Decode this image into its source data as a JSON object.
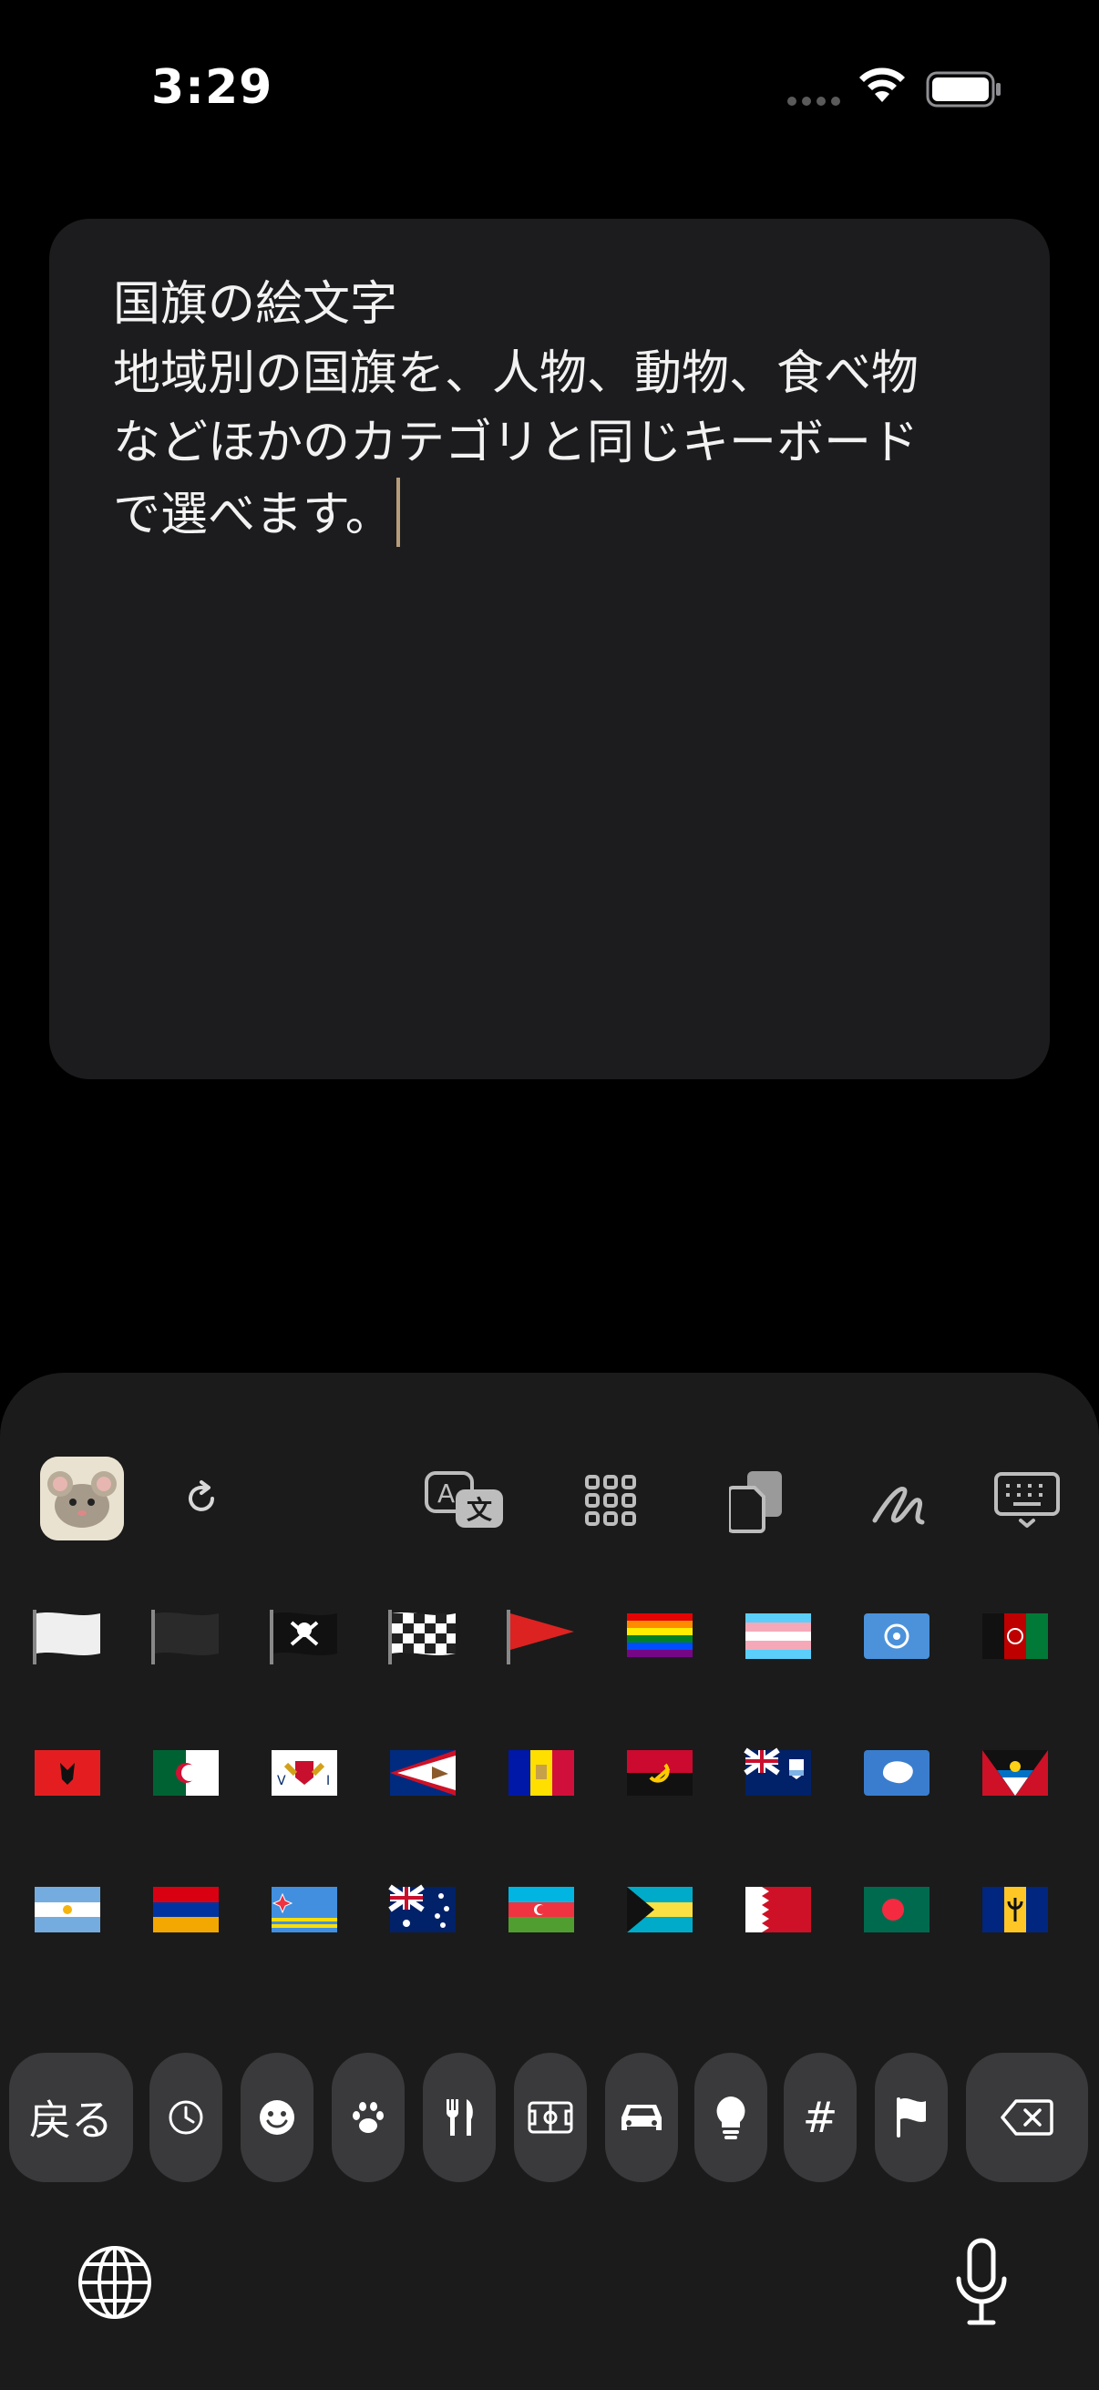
{
  "status_bar": {
    "time": "3:29"
  },
  "note": {
    "lines": [
      "国旗の絵文字",
      "地域別の国旗を、人物、動物、食べ物",
      "などほかのカテゴリと同じキーボード",
      "で選べます。"
    ]
  },
  "keyboard": {
    "toolbar": [
      "app-icon",
      "refresh-icon",
      "translate-icon",
      "grid-icon",
      "clipboard-icon",
      "handwriting-icon",
      "keyboard-icon"
    ],
    "flags_row1": [
      "white-flag",
      "black-flag",
      "pirate-flag",
      "checkered-flag",
      "triangular-flag",
      "rainbow-flag",
      "transgender-flag",
      "united-nations-flag",
      "afghanistan-flag"
    ],
    "flags_row2": [
      "albania-flag",
      "algeria-flag",
      "us-virgin-islands-flag",
      "american-samoa-flag",
      "andorra-flag",
      "angola-flag",
      "anguilla-flag",
      "antarctica-flag",
      "antigua-barbuda-flag"
    ],
    "flags_row3": [
      "argentina-flag",
      "armenia-flag",
      "aruba-flag",
      "australia-flag",
      "azerbaijan-flag",
      "bahamas-flag",
      "bahrain-flag",
      "bangladesh-flag",
      "barbados-flag"
    ],
    "back_label": "戻る",
    "categories": [
      "recent-icon",
      "smiley-icon",
      "paw-icon",
      "fork-knife-icon",
      "soccer-field-icon",
      "car-icon",
      "lightbulb-icon",
      "symbols-icon",
      "flag-icon"
    ],
    "symbols_label": "#",
    "colors": {
      "keyboard_bg": "#1b1b1b",
      "key_bg": "#3a3a3c",
      "card_bg": "#1c1c1e",
      "caret": "#b79c7c"
    }
  }
}
